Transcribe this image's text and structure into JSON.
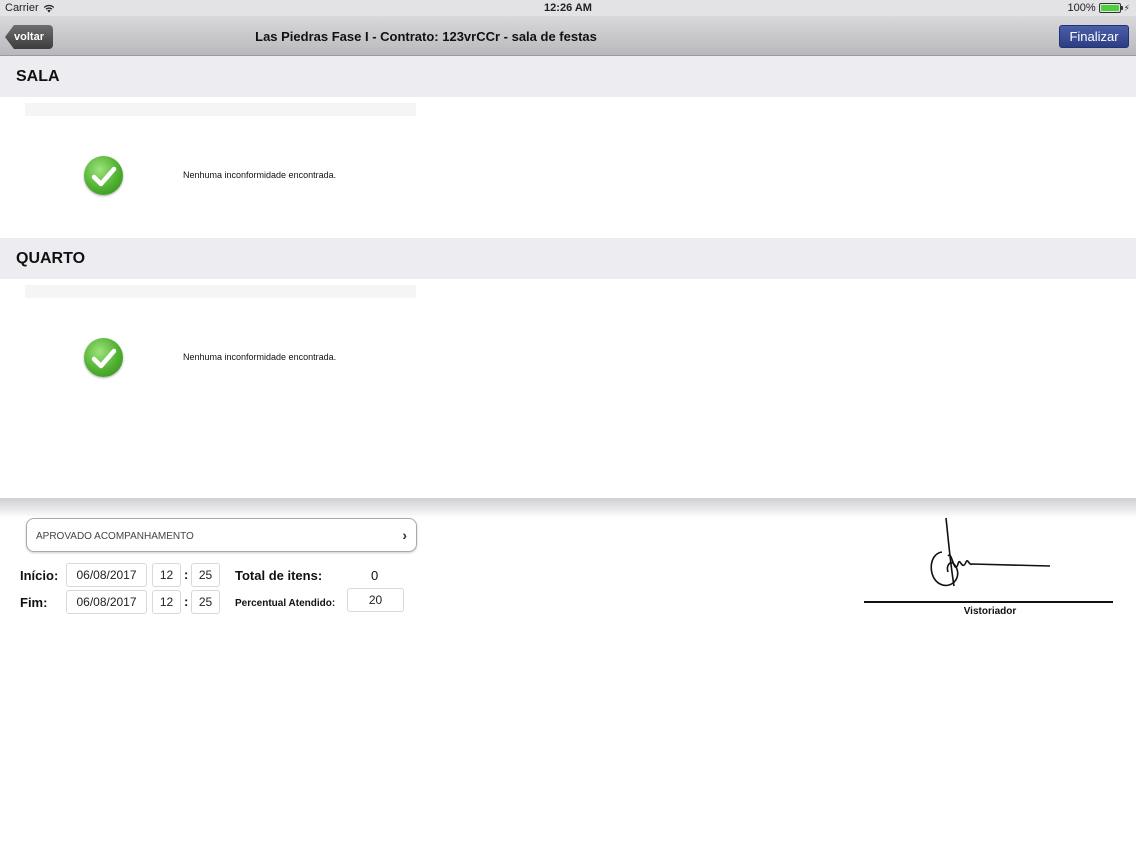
{
  "status_bar": {
    "carrier": "Carrier",
    "time": "12:26 AM",
    "battery": "100%"
  },
  "nav": {
    "back_label": "voltar",
    "title": "Las Piedras Fase I - Contrato: 123vrCCr - sala de festas",
    "finalize_label": "Finalizar"
  },
  "sections": [
    {
      "title": "SALA",
      "message": "Nenhuma inconformidade encontrada."
    },
    {
      "title": "QUARTO",
      "message": "Nenhuma inconformidade encontrada."
    }
  ],
  "form": {
    "status_select": "APROVADO ACOMPANHAMENTO",
    "inicio_label": "Início:",
    "inicio_date": "06/08/2017",
    "inicio_hour": "12",
    "inicio_minute": "25",
    "fim_label": "Fim:",
    "fim_date": "06/08/2017",
    "fim_hour": "12",
    "fim_minute": "25",
    "colon": ":",
    "total_label": "Total de itens:",
    "total_value": "0",
    "percent_label": "Percentual Atendido:",
    "percent_value": "20"
  },
  "signature": {
    "label": "Vistoriador"
  },
  "colors": {
    "accent": "#2c3d84",
    "success": "#4fb030"
  }
}
